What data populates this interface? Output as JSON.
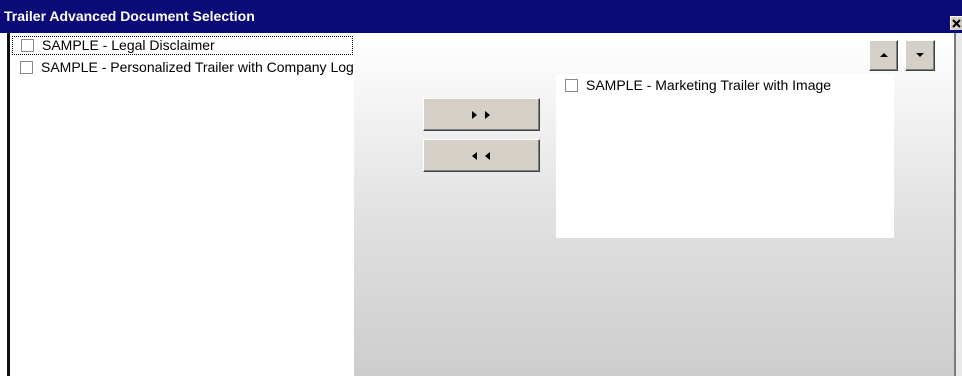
{
  "window": {
    "title": "Trailer Advanced Document Selection"
  },
  "available_list": {
    "items": [
      {
        "label": "SAMPLE - Legal Disclaimer",
        "checked": false,
        "focused": true
      },
      {
        "label": "SAMPLE - Personalized Trailer with Company Logo",
        "checked": false,
        "focused": false
      }
    ]
  },
  "selected_list": {
    "items": [
      {
        "label": "SAMPLE - Marketing Trailer with Image",
        "checked": false
      }
    ]
  },
  "buttons": {
    "add_icon": "double-right-arrow-icon",
    "remove_icon": "double-left-arrow-icon",
    "move_up_icon": "triangle-up-icon",
    "move_down_icon": "triangle-down-icon",
    "close_icon": "close-x-icon"
  },
  "colors": {
    "titlebar": "#0a0a78",
    "button_face": "#d4d0c8"
  }
}
